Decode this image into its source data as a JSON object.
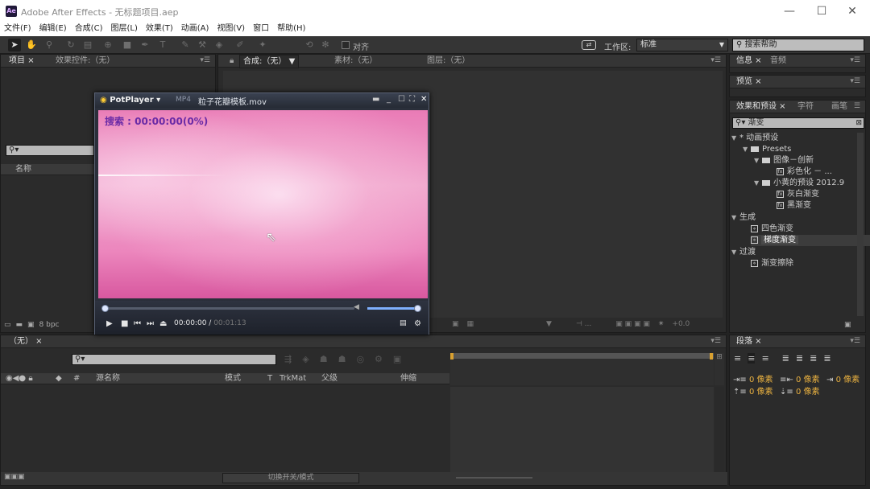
{
  "window": {
    "app_icon": "Ae",
    "title": "Adobe After Effects - 无标题项目.aep",
    "min_glyph": "—",
    "max_glyph": "☐",
    "close_glyph": "✕"
  },
  "menu": [
    "文件(F)",
    "编辑(E)",
    "合成(C)",
    "图层(L)",
    "效果(T)",
    "动画(A)",
    "视图(V)",
    "窗口",
    "帮助(H)"
  ],
  "toolbar": {
    "align_label": "对齐",
    "workspace_label": "工作区:",
    "workspace_value": "标准",
    "search_help": "搜索帮助"
  },
  "project_panel": {
    "tab_project": "项目",
    "tab_effects_controls": "效果控件:（无）",
    "col_name": "名称",
    "bpc": "8 bpc"
  },
  "comp_panel": {
    "tab_comp": "合成:（无）",
    "tab_footage": "素材:（无）",
    "tab_layer": "图层:（无）",
    "zoom_value": "+0.0"
  },
  "right_panels": {
    "tab_info": "信息",
    "tab_audio": "音频",
    "tab_preview": "预览",
    "tab_effects_presets": "效果和预设",
    "tab_character": "字符",
    "tab_paint": "画笔",
    "search_value": "渐变",
    "tree": {
      "animation_presets": "* 动画预设",
      "presets": "Presets",
      "folder1": "图像－创新",
      "item1": "彩色化 － ...",
      "folder2": "小黄的预设 2012.9",
      "item2": "灰白渐变",
      "item3": "黑渐变",
      "generate": "生成",
      "gen1": "四色渐变",
      "gen2": "梯度渐变",
      "transition": "过渡",
      "tr1": "渐变擦除"
    },
    "tab_paragraph": "段落",
    "indent1": "0 像素",
    "indent2": "0 像素",
    "indent3": "0 像素",
    "space1": "0 像素",
    "space2": "0 像素"
  },
  "timeline": {
    "tab_none": "（无）",
    "col_hash": "#",
    "col_source": "源名称",
    "col_mode": "模式",
    "col_t": "T",
    "col_trkmat": "TrkMat",
    "col_parent": "父级",
    "col_stretch": "伸缩",
    "toggle_label": "切换开关/模式"
  },
  "potplayer": {
    "logo": "PotPlayer",
    "format": "MP4",
    "filename": "粒子花瓣模板.mov",
    "seek_text": "搜索 : 00:00:00(0%)",
    "time_current": "00:00:00",
    "time_total": "00:01:13",
    "seek_fraction": 0.0,
    "volume_fraction": 1.0
  },
  "colors": {
    "ae_bg": "#232323",
    "panel": "#2b2b2b",
    "potplayer_seek_text": "#6a2aa6",
    "video_pink": "#ec86bd"
  }
}
